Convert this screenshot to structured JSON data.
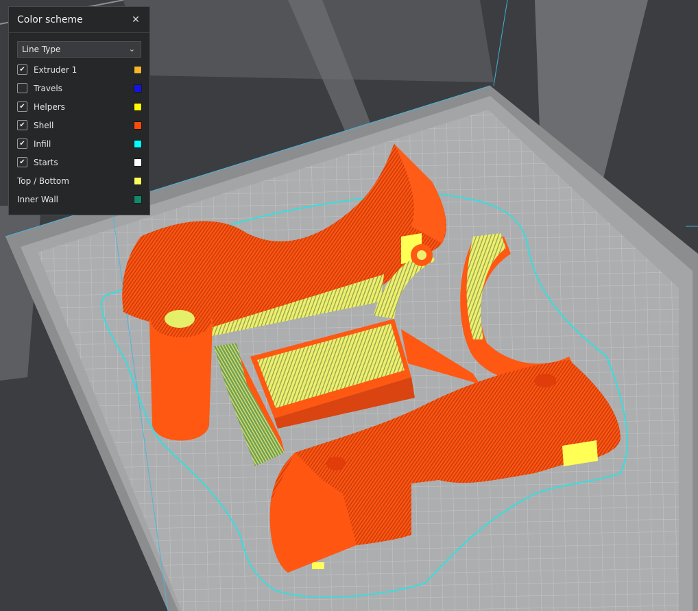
{
  "panel": {
    "title": "Color scheme",
    "close_icon": "close-icon",
    "dropdown": {
      "value": "Line Type",
      "icon": "chevron-down-icon"
    },
    "items": [
      {
        "label": "Extruder 1",
        "has_checkbox": true,
        "checked": true,
        "color": "#f5b62e"
      },
      {
        "label": "Travels",
        "has_checkbox": true,
        "checked": false,
        "color": "#1414e6"
      },
      {
        "label": "Helpers",
        "has_checkbox": true,
        "checked": true,
        "color": "#ffff00"
      },
      {
        "label": "Shell",
        "has_checkbox": true,
        "checked": true,
        "color": "#ff4a0a"
      },
      {
        "label": "Infill",
        "has_checkbox": true,
        "checked": true,
        "color": "#00ffff"
      },
      {
        "label": "Starts",
        "has_checkbox": true,
        "checked": true,
        "color": "#ffffff"
      },
      {
        "label": "Top / Bottom",
        "has_checkbox": false,
        "color": "#ffff59"
      },
      {
        "label": "Inner Wall",
        "has_checkbox": false,
        "color": "#0f8a6a"
      }
    ]
  },
  "colors": {
    "shell": "#ff5410",
    "infill": "#f2f06c",
    "travel_outline": "#35e0e0",
    "build_plate": "#a9aaab",
    "grid": "#c4c5c6"
  }
}
